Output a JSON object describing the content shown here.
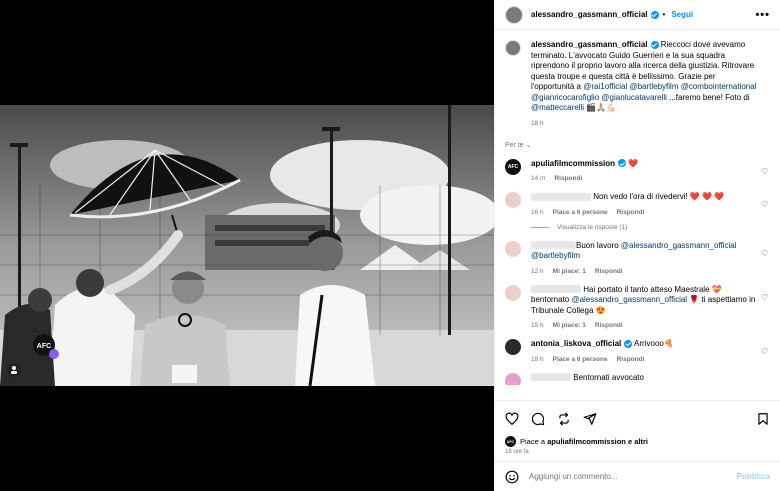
{
  "post": {
    "username": "alessandro_gassmann_official",
    "follow_label": "Segui",
    "more_label": "•••",
    "caption_user": "alessandro_gassmann_official",
    "caption_text_1": " Rieccoci dove avevamo terminato. L'avvocato Guido Guerrieri e la sua squadra riprendono il proprio lavoro alla ricerca della giustizia. Ritrovare questa troupe e questa città è bellissimo. Grazie per l'opportunità a ",
    "tag_1": "@rai1official",
    "tag_2": "@bartlebyfilm",
    "tag_3": "@combointernational",
    "tag_4": "@gianricocarofiglio",
    "tag_5": "@gianlucatavarelli",
    "caption_text_2": " ...faremo bene! Foto di ",
    "tag_6": "@matteccarelli",
    "caption_emoji": " 🎬🙏🏼💪🏻",
    "caption_time": "18 h",
    "translate_label": "Per te ⌄"
  },
  "comments": [
    {
      "user": "apuliafilmcommission",
      "text": " ❤️",
      "time": "14 m",
      "reply": "Rispondi"
    },
    {
      "user": "",
      "text": "Non vedo l'ora di rivedervi! ❤️ ❤️ ❤️",
      "time": "16 h",
      "likes": "Piace a 6 persone",
      "reply": "Rispondi",
      "view_replies": "Visualizza le risposte (1)"
    },
    {
      "user": "",
      "text_pre": "Buon lavoro ",
      "tag": "@alessandro_gassmann_official",
      "tag2": "@bartlebyfilm",
      "time": "12 h",
      "likes": "Mi piace: 1",
      "reply": "Rispondi"
    },
    {
      "user": "",
      "text_pre": "Hai portato il tanto atteso Maestrale 💝 bentornato ",
      "tag": "@alessandro_gassmann_official",
      "text_post": " 🌹 ti aspettiamo in Tribunale Collega 😍",
      "time": "15 h",
      "likes": "Mi piace: 1",
      "reply": "Rispondi"
    },
    {
      "user": "antonia_liskova_official",
      "text": " Arrivooo🍕",
      "time": "18 h",
      "likes": "Piace a 6 persone",
      "reply": "Rispondi"
    },
    {
      "user": "",
      "text": "Bentornati avvocato"
    }
  ],
  "footer": {
    "liked_by": "Piace a ",
    "liked_user": "apuliafilmcommission",
    "liked_others": " e altri",
    "ago": "18 ore fa",
    "comment_placeholder": "Aggiungi un commento...",
    "publish_label": "Pubblica"
  },
  "photo": {
    "badge": "AFC"
  }
}
